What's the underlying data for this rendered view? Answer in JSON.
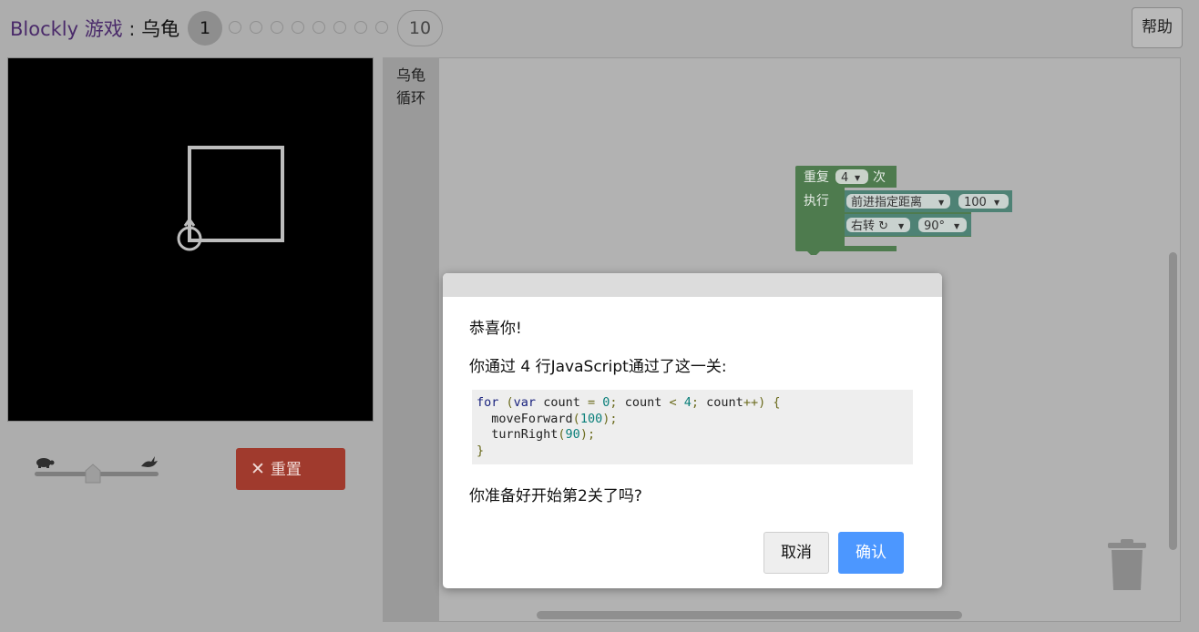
{
  "header": {
    "title_brand": "Blockly 游戏",
    "title_sep": " : ",
    "title_game": "乌龟",
    "current_level": "1",
    "last_level": "10",
    "help_label": "帮助"
  },
  "controls": {
    "reset_label": "重置",
    "speed_value": 0.47
  },
  "toolbox": {
    "categories": [
      "乌龟",
      "循环"
    ]
  },
  "blocks": {
    "repeat_label": "重复",
    "repeat_count": "4",
    "times_label": "次",
    "do_label": "执行",
    "move_label": "前进指定距离",
    "move_value": "100",
    "turn_label": "右转 ↻",
    "turn_value": "90°"
  },
  "dialog": {
    "congrats": "恭喜你!",
    "summary": "你通过 4 行JavaScript通过了这一关:",
    "code_lines": [
      "for (var count = 0; count < 4; count++) {",
      "  moveForward(100);",
      "  turnRight(90);",
      "}"
    ],
    "prompt": "你准备好开始第2关了吗?",
    "cancel_label": "取消",
    "ok_label": "确认"
  },
  "colors": {
    "loop_block": "#4e7b4e",
    "turtle_block": "#4e8275",
    "reset_button": "#a03a2d",
    "ok_button": "#4c97ff"
  }
}
